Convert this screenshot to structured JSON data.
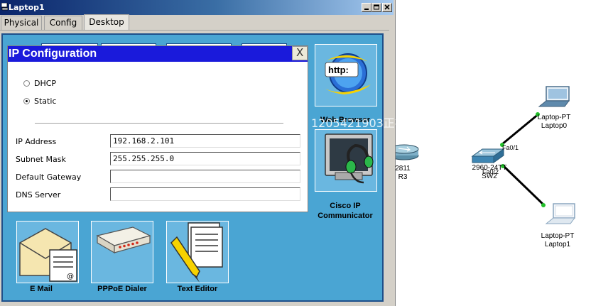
{
  "window": {
    "title": "Laptop1",
    "tabs": [
      {
        "label": "Physical",
        "active": false
      },
      {
        "label": "Config",
        "active": false
      },
      {
        "label": "Desktop",
        "active": true
      }
    ]
  },
  "ip_config": {
    "title": "IP Configuration",
    "close_label": "X",
    "modes": [
      {
        "label": "DHCP",
        "selected": false
      },
      {
        "label": "Static",
        "selected": true
      }
    ],
    "fields": [
      {
        "label": "IP Address",
        "value": "192.168.2.101"
      },
      {
        "label": "Subnet Mask",
        "value": "255.255.255.0"
      },
      {
        "label": "Default Gateway",
        "value": ""
      },
      {
        "label": "DNS Server",
        "value": ""
      }
    ]
  },
  "apps": {
    "web_browser": {
      "label": "Web Browser",
      "icon": "globe-icon",
      "badge": "http:"
    },
    "cisco_ip_communicator": {
      "label_line1": "Cisco IP",
      "label_line2": "Communicator",
      "icon": "monitor-headset-icon"
    },
    "email": {
      "label": "E Mail",
      "icon": "envelope-icon"
    },
    "pppoe": {
      "label": "PPPoE Dialer",
      "icon": "modem-icon"
    },
    "text_editor": {
      "label": "Text Editor",
      "icon": "document-pencil-icon"
    }
  },
  "watermark": "1205421903正在观看视频",
  "topology": {
    "router": {
      "model": "2811",
      "name": "R3"
    },
    "switch": {
      "model": "2960-24TT",
      "name": "SW2"
    },
    "laptop0": {
      "model": "Laptop-PT",
      "name": "Laptop0"
    },
    "laptop1": {
      "model": "Laptop-PT",
      "name": "Laptop1"
    },
    "ports": {
      "to_laptop0": "Fa0/1",
      "to_laptop1": "Fa0/2"
    },
    "colors": {
      "link": "#000000",
      "link_up": "#22c02a"
    }
  }
}
